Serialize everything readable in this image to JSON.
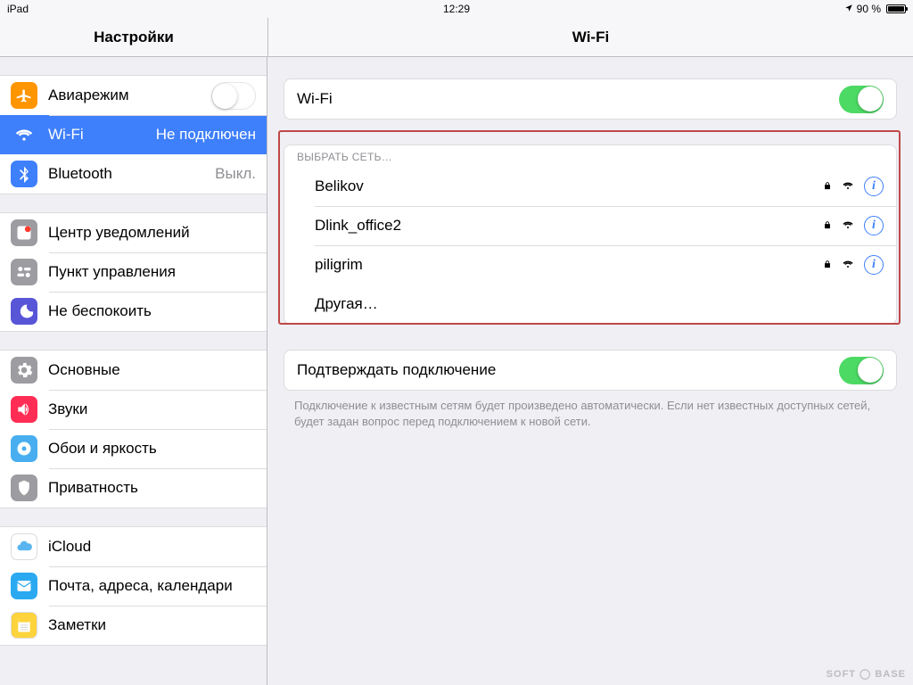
{
  "status": {
    "device": "iPad",
    "time": "12:29",
    "battery": "90 %"
  },
  "headers": {
    "left": "Настройки",
    "right": "Wi-Fi"
  },
  "sidebar": {
    "g1": [
      {
        "icon": "airplane",
        "color": "#ff9500",
        "label": "Авиарежим",
        "toggle": false
      },
      {
        "icon": "wifi",
        "color": "#3e7ffb",
        "label": "Wi-Fi",
        "value": "Не подключен",
        "selected": true
      },
      {
        "icon": "bluetooth",
        "color": "#3e7ffb",
        "label": "Bluetooth",
        "value": "Выкл."
      }
    ],
    "g2": [
      {
        "icon": "notif",
        "color": "#9c9ca1",
        "label": "Центр уведомлений"
      },
      {
        "icon": "control",
        "color": "#9c9ca1",
        "label": "Пункт управления"
      },
      {
        "icon": "dnd",
        "color": "#5856d6",
        "label": "Не беспокоить"
      }
    ],
    "g3": [
      {
        "icon": "general",
        "color": "#9c9ca1",
        "label": "Основные"
      },
      {
        "icon": "sounds",
        "color": "#ff2d55",
        "label": "Звуки"
      },
      {
        "icon": "wall",
        "color": "#48aef0",
        "label": "Обои и яркость"
      },
      {
        "icon": "privacy",
        "color": "#9c9ca1",
        "label": "Приватность"
      }
    ],
    "g4": [
      {
        "icon": "icloud",
        "color": "#ffffff",
        "label": "iCloud"
      },
      {
        "icon": "mail",
        "color": "#2aa9f1",
        "label": "Почта, адреса, календари"
      },
      {
        "icon": "notes",
        "color": "#ffd33c",
        "label": "Заметки"
      }
    ]
  },
  "detail": {
    "wifi_label": "Wi-Fi",
    "select_header": "ВЫБРАТЬ СЕТЬ…",
    "networks": [
      {
        "name": "Belikov",
        "locked": true
      },
      {
        "name": "Dlink_office2",
        "locked": true
      },
      {
        "name": "piligrim",
        "locked": true
      }
    ],
    "other": "Другая…",
    "ask_label": "Подтверждать подключение",
    "footnote": "Подключение к известным сетям будет произведено автоматически. Если нет известных доступных сетей, будет задан вопрос перед подключением к новой сети."
  },
  "watermark": "SOFT ◯ BASE"
}
